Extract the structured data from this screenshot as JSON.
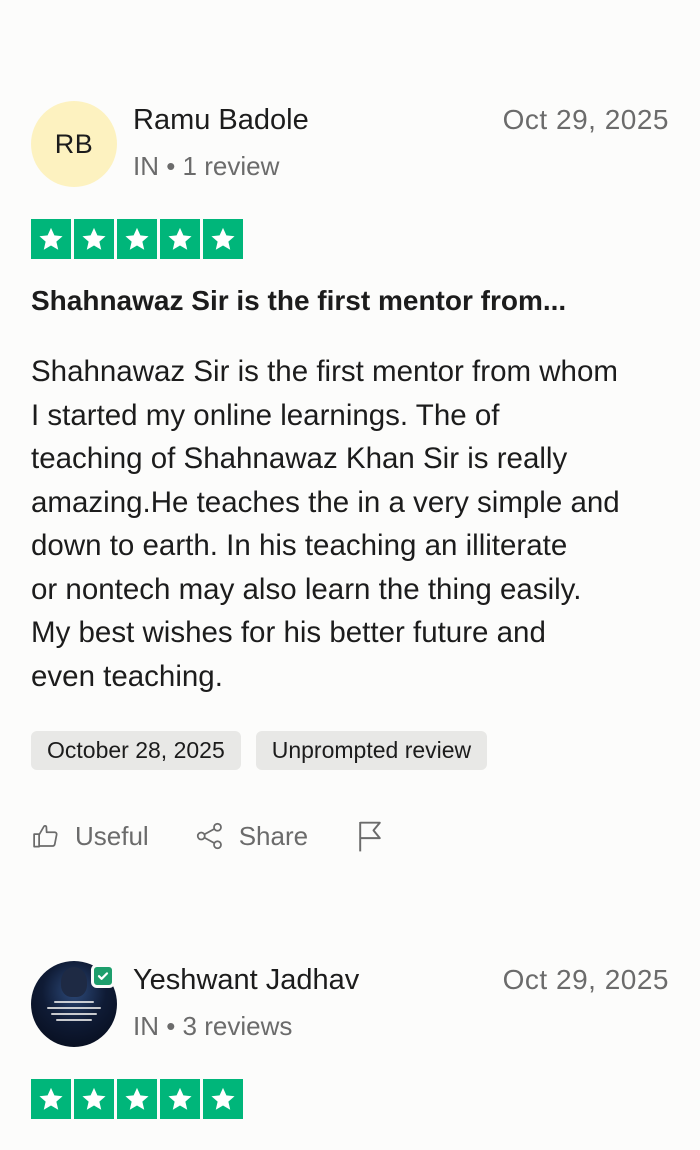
{
  "reviews": [
    {
      "initials": "RB",
      "name": "Ramu Badole",
      "meta": "IN • 1 review",
      "date": "Oct 29, 2025",
      "rating": 5,
      "title": "Shahnawaz Sir is the first mentor from...",
      "body_lines": [
        "Shahnawaz Sir is the first mentor from whom",
        "I started my online learnings. The of",
        "teaching of Shahnawaz Khan Sir is really",
        "amazing.He teaches the in a very simple and",
        "down to earth. In his teaching an illiterate",
        "or nontech may also learn the thing easily.",
        "My best wishes for his better future and",
        "even teaching."
      ],
      "tags": [
        "October 28, 2025",
        "Unprompted review"
      ],
      "actions": {
        "useful": "Useful",
        "share": "Share"
      }
    },
    {
      "name": "Yeshwant Jadhav",
      "meta": "IN • 3 reviews",
      "date": "Oct 29, 2025",
      "rating": 5,
      "verified": true
    }
  ],
  "colors": {
    "star_green": "#00b67a",
    "avatar_bg": "#fdf2c0",
    "verified_green": "#1d9e6c"
  },
  "icons": [
    "star-icon",
    "thumbs-up-icon",
    "share-icon",
    "flag-icon",
    "verified-check-icon"
  ]
}
